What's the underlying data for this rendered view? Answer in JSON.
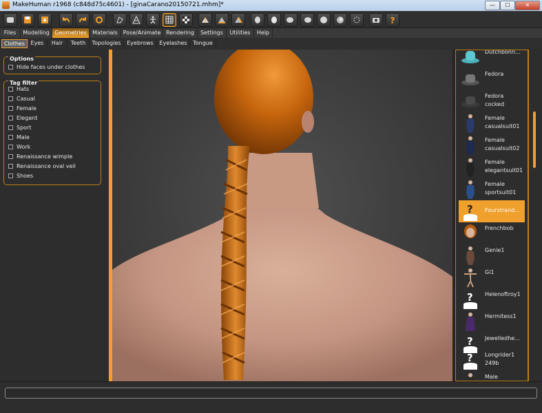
{
  "window": {
    "title": "MakeHuman r1968 (c848d75c4601) - [ginaCarano20150721.mhm]*",
    "min_glyph": "—",
    "max_glyph": "☐",
    "close_glyph": "✕"
  },
  "toolbar": {
    "icons": [
      "undo-icon",
      "redo-icon",
      "reset-icon",
      "smooth-icon",
      "wireframe-icon",
      "pose-icon",
      "grid-icon",
      "checker-icon",
      "front-view-icon",
      "back-view-icon",
      "left-view-icon",
      "right-view-icon",
      "top-view-icon",
      "bottom-view-icon",
      "reset-camera-icon",
      "screenshot-icon",
      "help-icon"
    ]
  },
  "menu_tabs": [
    "Files",
    "Modelling",
    "Geometries",
    "Materials",
    "Pose/Animate",
    "Rendering",
    "Settings",
    "Utilities",
    "Help"
  ],
  "active_menu_tab": "Geometries",
  "sub_tabs": [
    "Clothes",
    "Eyes",
    "Hair",
    "Teeth",
    "Topologies",
    "Eyebrows",
    "Eyelashes",
    "Tongue"
  ],
  "active_sub_tab": "Clothes",
  "options": {
    "title": "Options",
    "hide_faces": "Hide faces under clothes"
  },
  "tag_filter": {
    "title": "Tag filter",
    "tags": [
      "Hats",
      "Casual",
      "Female",
      "Elegant",
      "Sport",
      "Male",
      "Work",
      "Renaissance wimple",
      "Renaissance oval veil",
      "Shoes"
    ]
  },
  "library": {
    "items": [
      {
        "label": "Dutchbonn...",
        "thumb": "hat"
      },
      {
        "label": "Fedora",
        "thumb": "hat"
      },
      {
        "label": "Fedora\ncocked",
        "thumb": "hat"
      },
      {
        "label": "Female\ncasualsuit01",
        "thumb": "figure"
      },
      {
        "label": "Female\ncasualsuit02",
        "thumb": "figure"
      },
      {
        "label": "Female\nelegantsuit01",
        "thumb": "figure"
      },
      {
        "label": "Female\nsportsuit01",
        "thumb": "figure"
      },
      {
        "label": "Fourstrand...",
        "thumb": "notfound"
      },
      {
        "label": "Frenchbob",
        "thumb": "hair"
      },
      {
        "label": "Genie1",
        "thumb": "figure"
      },
      {
        "label": "Gi1",
        "thumb": "figure"
      },
      {
        "label": "Helenoftroy1",
        "thumb": "notfound"
      },
      {
        "label": "Hermitess1",
        "thumb": "figure"
      },
      {
        "label": "Jewelledhe...",
        "thumb": "notfound"
      },
      {
        "label": "Longrider1\n249b",
        "thumb": "notfound"
      },
      {
        "label": "Male",
        "thumb": "figure"
      }
    ],
    "selected": "Fourstrand..."
  },
  "status": {
    "text": ""
  },
  "colors": {
    "accent": "#f0a02c",
    "hair": "#c6650d",
    "skin": "#c99a83"
  }
}
